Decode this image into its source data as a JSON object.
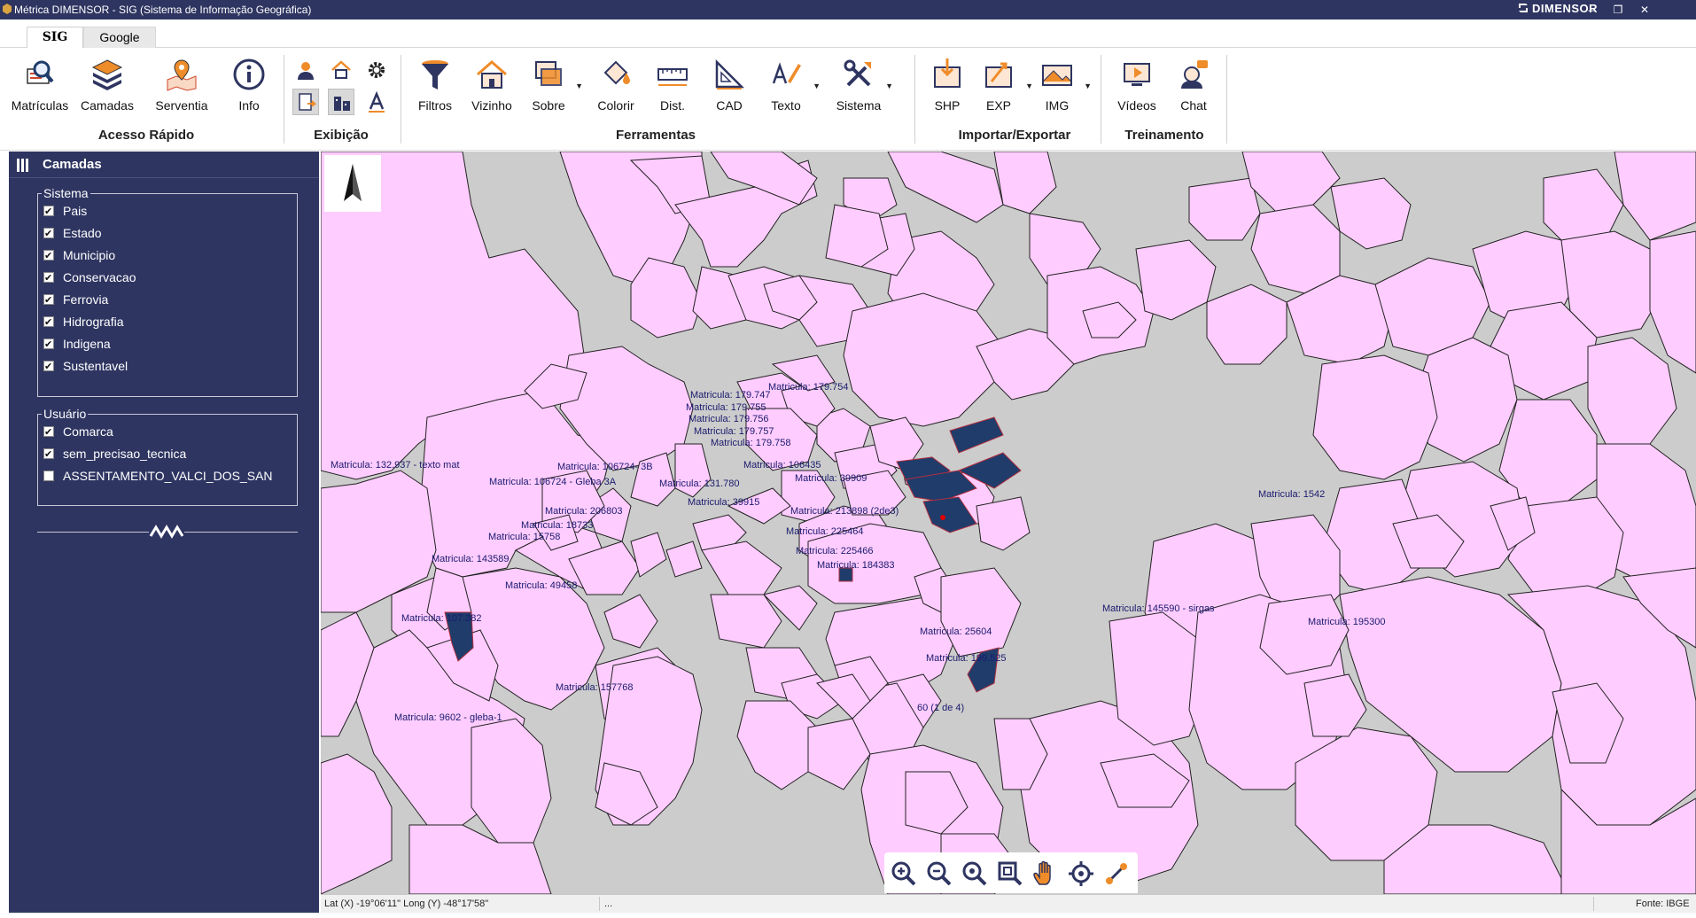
{
  "window": {
    "title": "Métrica DIMENSOR - SIG (Sistema de Informação Geográfica)",
    "brand": "DIMENSOR",
    "minimize_icon": "minimize-icon",
    "maximize_icon": "restore-icon",
    "close_icon": "close-icon"
  },
  "ribbon_tabs": [
    {
      "label": "SIG",
      "active": true
    },
    {
      "label": "Google",
      "active": false
    }
  ],
  "ribbon": {
    "acesso_rapido": {
      "label": "Acesso Rápido",
      "buttons": [
        {
          "label": "Matrículas",
          "icon": "magnifier-document-icon"
        },
        {
          "label": "Camadas",
          "icon": "layers-icon"
        },
        {
          "label": "Serventia",
          "icon": "map-pin-icon"
        },
        {
          "label": "Info",
          "icon": "info-icon"
        }
      ]
    },
    "exibicao": {
      "label": "Exibição",
      "buttons": [
        "user-icon",
        "home-icon",
        "gear-icon",
        "document-arrow-icon",
        "buildings-icon",
        "text-a-icon"
      ]
    },
    "ferramentas": {
      "label": "Ferramentas",
      "buttons": [
        {
          "label": "Filtros",
          "icon": "funnel-icon"
        },
        {
          "label": "Vizinho",
          "icon": "house-neighbor-icon"
        },
        {
          "label": "Sobre",
          "icon": "overlay-icon"
        },
        {
          "label": "Colorir",
          "icon": "paint-bucket-icon"
        },
        {
          "label": "Dist.",
          "icon": "ruler-icon"
        },
        {
          "label": "CAD",
          "icon": "set-square-icon"
        },
        {
          "label": "Texto",
          "icon": "pen-text-icon"
        },
        {
          "label": "Sistema",
          "icon": "tools-icon"
        }
      ]
    },
    "importar_exportar": {
      "label": "Importar/Exportar",
      "buttons": [
        {
          "label": "SHP",
          "icon": "shp-import-icon"
        },
        {
          "label": "EXP",
          "icon": "export-icon"
        },
        {
          "label": "IMG",
          "icon": "image-map-icon"
        }
      ]
    },
    "treinamento": {
      "label": "Treinamento",
      "buttons": [
        {
          "label": "Vídeos",
          "icon": "video-icon"
        },
        {
          "label": "Chat",
          "icon": "chat-support-icon"
        }
      ]
    }
  },
  "panel": {
    "title": "Camadas",
    "sistema": {
      "label": "Sistema",
      "items": [
        {
          "label": "Pais",
          "checked": true
        },
        {
          "label": "Estado",
          "checked": true
        },
        {
          "label": "Municipio",
          "checked": true
        },
        {
          "label": "Conservacao",
          "checked": true
        },
        {
          "label": "Ferrovia",
          "checked": true
        },
        {
          "label": "Hidrografia",
          "checked": true
        },
        {
          "label": "Indigena",
          "checked": true
        },
        {
          "label": "Sustentavel",
          "checked": true
        }
      ]
    },
    "usuario": {
      "label": "Usuário",
      "items": [
        {
          "label": "Comarca",
          "checked": true
        },
        {
          "label": "sem_precisao_tecnica",
          "checked": true
        },
        {
          "label": "ASSENTAMENTO_VALCI_DOS_SAN",
          "checked": false
        }
      ]
    }
  },
  "map": {
    "labels": [
      "Matricula: 179.747",
      "Matricula: 179.754",
      "Matricula: 179.755",
      "Matricula: 179.756",
      "Matricula: 179.757",
      "Matricula: 179.758",
      "Matricula: 132.937 - texto mat",
      "Matricula: 106724- 3B",
      "Matricula: 106435",
      "Matricula: 106724 - Gleba 3A",
      "Matricula: 131.780",
      "Matricula: 39909",
      "Matricula: 39915",
      "Matricula: 206803",
      "Matricula: 213898 (2de3)",
      "Matricula: 18733",
      "Matricula: 15758",
      "Matricula: 225464",
      "Matricula: 1542",
      "Matricula: 225466",
      "Matricula: 143589",
      "Matricula: 184383",
      "Matricula: 49458",
      "Matricula: 145590 - sirgas",
      "Matricula: 107.382",
      "Matricula: 195300",
      "Matricula: 25604",
      "Matricula: 199.525",
      "Matricula: 157768",
      "Matricula: 9602 - gleba-1",
      "60 (1 de 4)"
    ],
    "tools": [
      "zoom-in-icon",
      "zoom-out-icon",
      "zoom-extent-icon",
      "zoom-window-icon",
      "pan-hand-icon",
      "locate-target-icon",
      "measure-icon"
    ],
    "north_arrow": "north-arrow-icon"
  },
  "status": {
    "coords": "Lat (X) -19°06'11\" Long (Y) -48°17'58\"",
    "middle": "...",
    "source": "Fonte: IBGE"
  },
  "colors": {
    "titlebar": "#2e3561",
    "panel": "#2e3561",
    "parcel_fill": "#ffccff",
    "parcel_selected": "#1f3c6b",
    "map_background": "#cccccc",
    "label_color": "#1a1a6e"
  }
}
